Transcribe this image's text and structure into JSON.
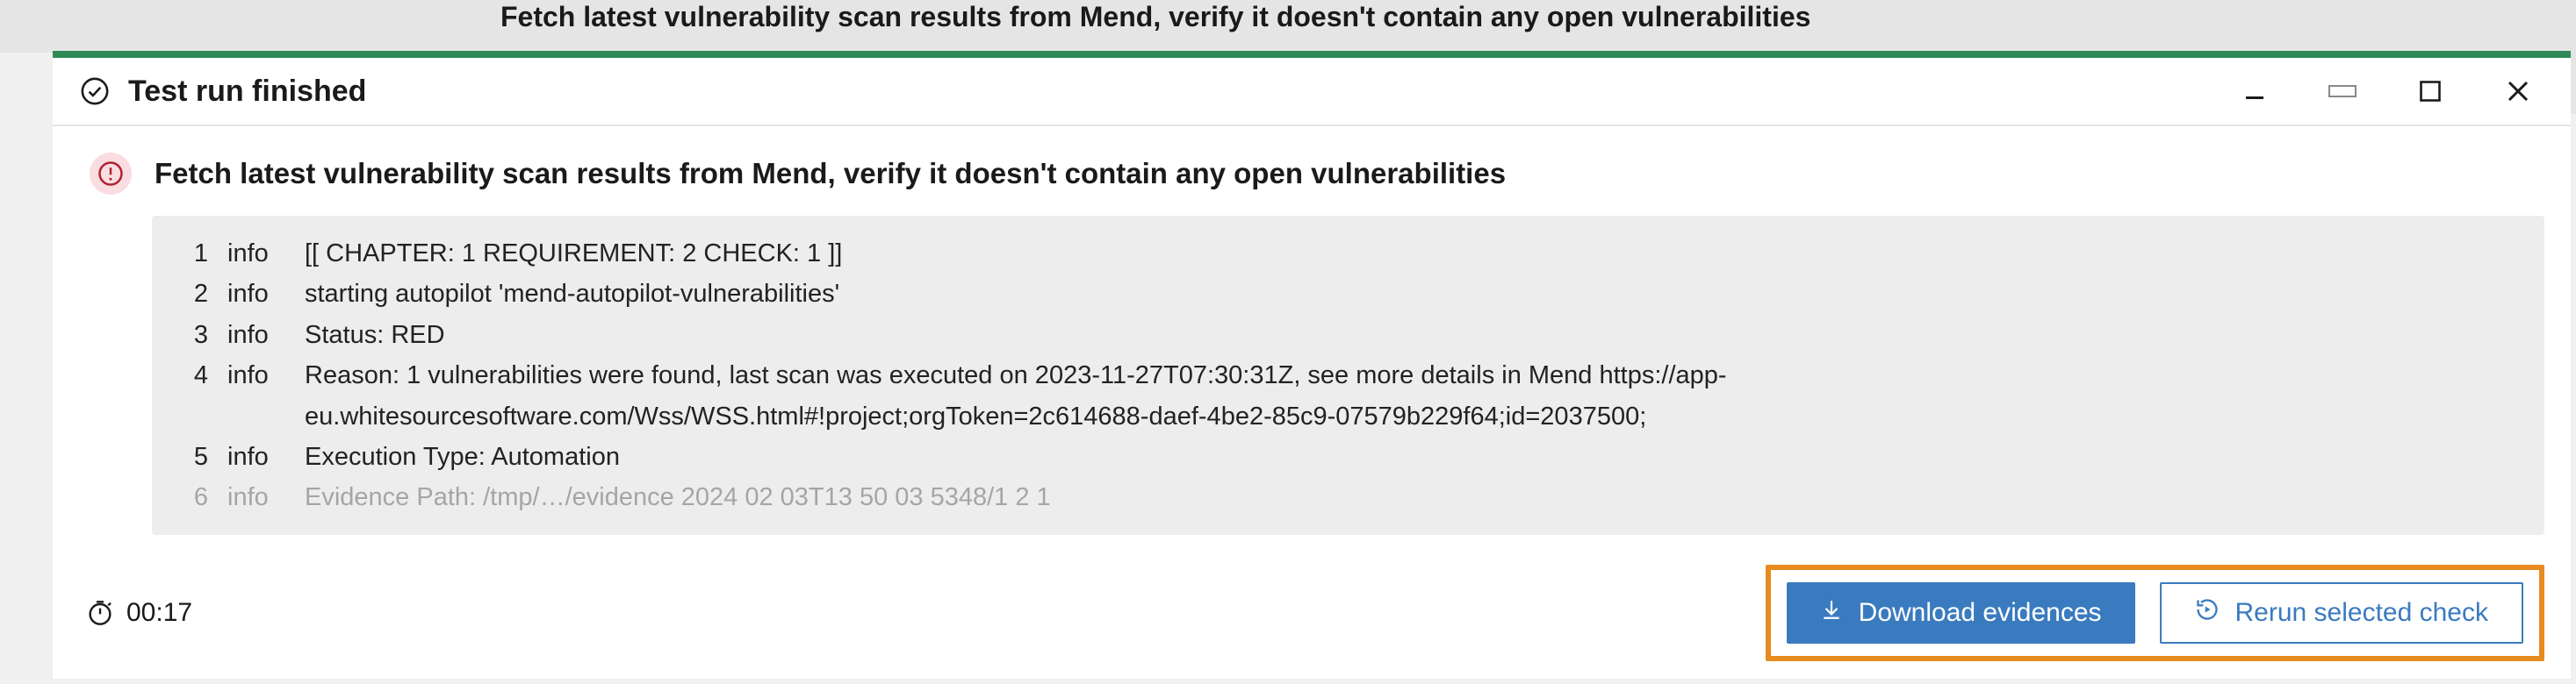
{
  "bg_header_text": "Fetch latest vulnerability scan results from Mend, verify it doesn't contain any open vulnerabilities",
  "titlebar": {
    "title": "Test run finished"
  },
  "subheader": {
    "title": "Fetch latest vulnerability scan results from Mend, verify it doesn't contain any open vulnerabilities"
  },
  "log": [
    {
      "n": "1",
      "level": "info",
      "msg": "[[ CHAPTER: 1 REQUIREMENT: 2 CHECK: 1 ]]"
    },
    {
      "n": "2",
      "level": "info",
      "msg": "starting autopilot 'mend-autopilot-vulnerabilities'"
    },
    {
      "n": "3",
      "level": "info",
      "msg": "  Status: RED"
    },
    {
      "n": "4",
      "level": "info",
      "msg": "  Reason: 1 vulnerabilities were found, last scan was executed on 2023-11-27T07:30:31Z, see more details in Mend https://app-eu.whitesourcesoftware.com/Wss/WSS.html#!project;orgToken=2c614688-daef-4be2-85c9-07579b229f64;id=2037500;"
    },
    {
      "n": "5",
      "level": "info",
      "msg": "  Execution Type: Automation"
    },
    {
      "n": "6",
      "level": "info",
      "msg": "  Evidence Path: /tmp/…/evidence 2024 02 03T13 50 03 5348/1 2 1"
    }
  ],
  "footer": {
    "time": "00:17",
    "download_label": "Download evidences",
    "rerun_label": "Rerun selected check"
  }
}
